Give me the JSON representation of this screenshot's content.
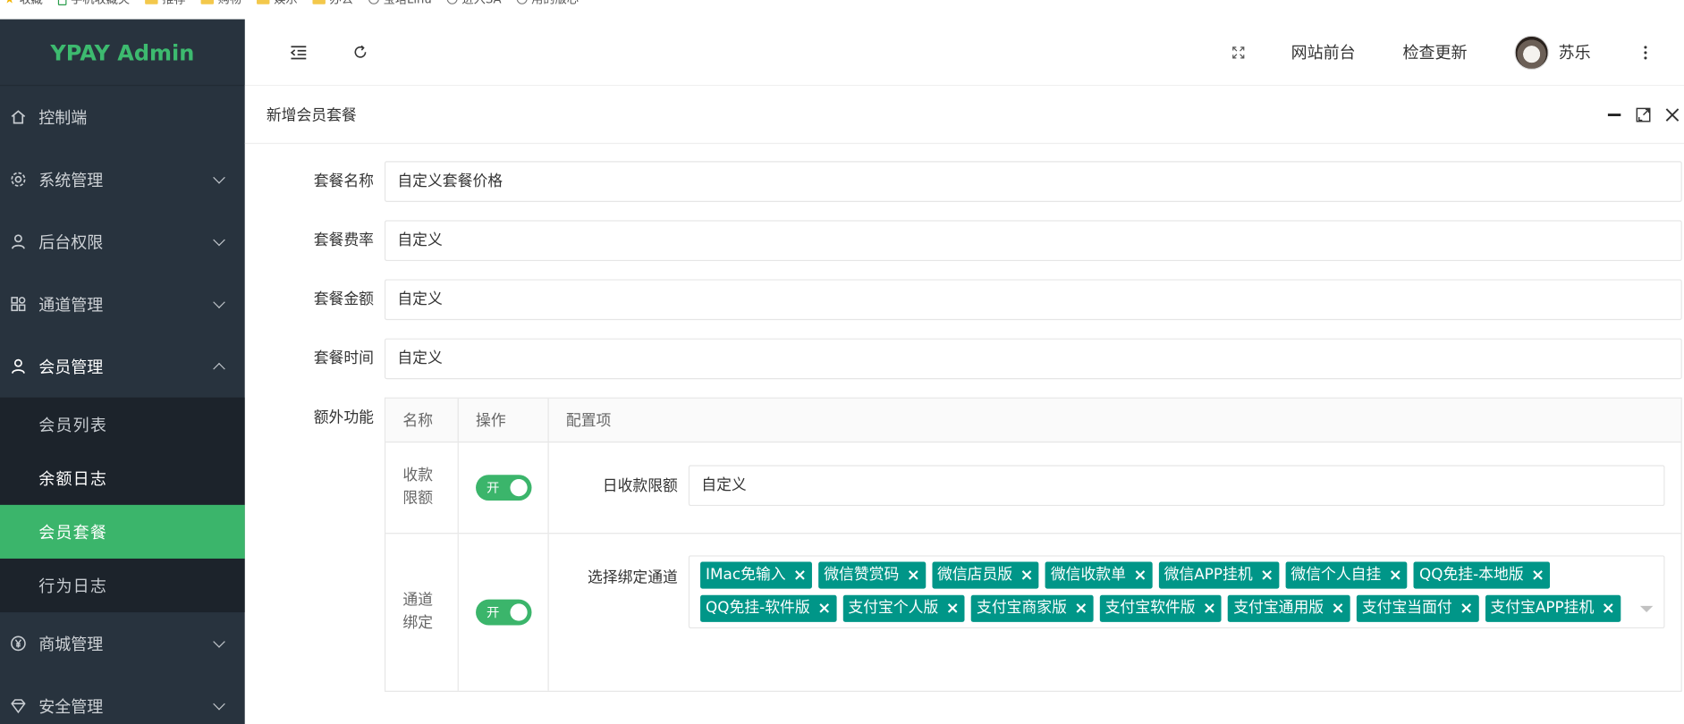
{
  "bookmarks": [
    {
      "label": "收藏",
      "kind": "star"
    },
    {
      "label": "手机收藏夹",
      "kind": "phone"
    },
    {
      "label": "推荐",
      "kind": "folder"
    },
    {
      "label": "购物",
      "kind": "folder"
    },
    {
      "label": "娱乐",
      "kind": "folder"
    },
    {
      "label": "办公",
      "kind": "folder"
    },
    {
      "label": "宝塔Linu",
      "kind": "globe"
    },
    {
      "label": "进入SA",
      "kind": "globe"
    },
    {
      "label": "用的版心",
      "kind": "globe"
    }
  ],
  "sidebar": {
    "logo": "YPAY Admin",
    "items": [
      {
        "label": "控制端",
        "icon": "home-icon"
      },
      {
        "label": "系统管理",
        "icon": "gear-icon"
      },
      {
        "label": "后台权限",
        "icon": "user-icon"
      },
      {
        "label": "通道管理",
        "icon": "apps-icon"
      },
      {
        "label": "会员管理",
        "icon": "user-icon"
      },
      {
        "label": "商城管理",
        "icon": "yen-icon"
      },
      {
        "label": "安全管理",
        "icon": "diamond-icon"
      }
    ],
    "submenu": [
      "会员列表",
      "余额日志",
      "会员套餐",
      "行为日志"
    ],
    "active_submenu": "会员套餐"
  },
  "header": {
    "fullscreen_icon": "fullscreen-icon",
    "site_front": "网站前台",
    "check_update": "检查更新",
    "username": "苏乐"
  },
  "panel": {
    "title": "新增会员套餐"
  },
  "form": {
    "name_label": "套餐名称",
    "name_value": "自定义套餐价格",
    "rate_label": "套餐费率",
    "rate_value": "自定义",
    "amount_label": "套餐金额",
    "amount_value": "自定义",
    "time_label": "套餐时间",
    "time_value": "自定义",
    "extra_label": "额外功能"
  },
  "extra_table": {
    "headers": [
      "名称",
      "操作",
      "配置项"
    ],
    "row1": {
      "name": "收款限额",
      "switch": "开",
      "field_label": "日收款限额",
      "field_value": "自定义"
    },
    "row2": {
      "name": "通道绑定",
      "switch": "开",
      "field_label": "选择绑定通道",
      "tags": [
        "IMac免输入",
        "微信赞赏码",
        "微信店员版",
        "微信收款单",
        "微信APP挂机",
        "微信个人自挂",
        "QQ免挂-本地版",
        "QQ免挂-软件版",
        "支付宝个人版",
        "支付宝商家版",
        "支付宝软件版",
        "支付宝通用版",
        "支付宝当面付",
        "支付宝APP挂机"
      ]
    }
  },
  "colors": {
    "accent": "#3bb56b",
    "tag": "#009688",
    "sidebar": "#28333e"
  }
}
